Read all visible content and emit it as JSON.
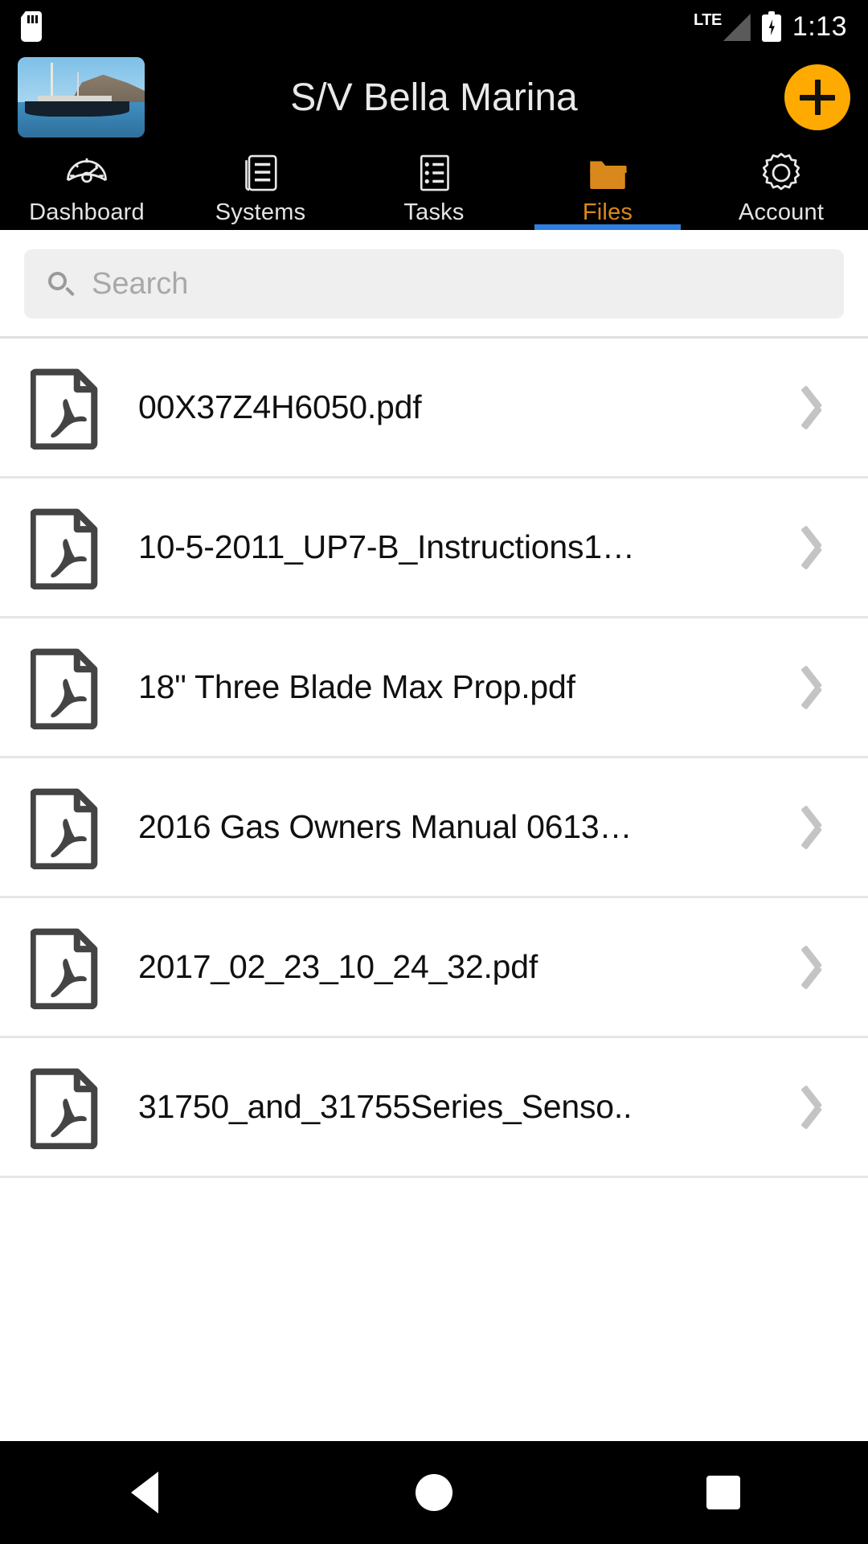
{
  "status_bar": {
    "sdcard_icon": "sdcard-icon",
    "network": "LTE",
    "signal_icon": "signal-bars-icon",
    "battery_icon": "battery-charging-icon",
    "time": "1:13"
  },
  "app_bar": {
    "thumbnail_icon": "sailboat-thumbnail",
    "title": "S/V Bella Marina",
    "add_button_icon": "plus-icon",
    "accent_color": "#FFAA00"
  },
  "tabs": {
    "active_color": "#D9891B",
    "indicator_color": "#2F7FE0",
    "items": [
      {
        "label": "Dashboard",
        "icon": "gauge-icon",
        "active": false
      },
      {
        "label": "Systems",
        "icon": "document-icon",
        "active": false
      },
      {
        "label": "Tasks",
        "icon": "checklist-icon",
        "active": false
      },
      {
        "label": "Files",
        "icon": "folder-icon",
        "active": true
      },
      {
        "label": "Account",
        "icon": "gear-icon",
        "active": false
      }
    ]
  },
  "search": {
    "icon": "search-icon",
    "placeholder": "Search",
    "value": ""
  },
  "files": {
    "row_icon": "pdf-file-icon",
    "chevron_icon": "chevron-right-icon",
    "items": [
      {
        "name": "00X37Z4H6050.pdf"
      },
      {
        "name": "10-5-2011_UP7-B_Instructions1…"
      },
      {
        "name": "18\" Three Blade Max Prop.pdf"
      },
      {
        "name": "2016 Gas Owners Manual 0613…"
      },
      {
        "name": "2017_02_23_10_24_32.pdf"
      },
      {
        "name": "31750_and_31755Series_Senso.."
      }
    ]
  },
  "nav_bar": {
    "back_icon": "back-triangle-icon",
    "home_icon": "home-circle-icon",
    "recents_icon": "recents-square-icon"
  }
}
